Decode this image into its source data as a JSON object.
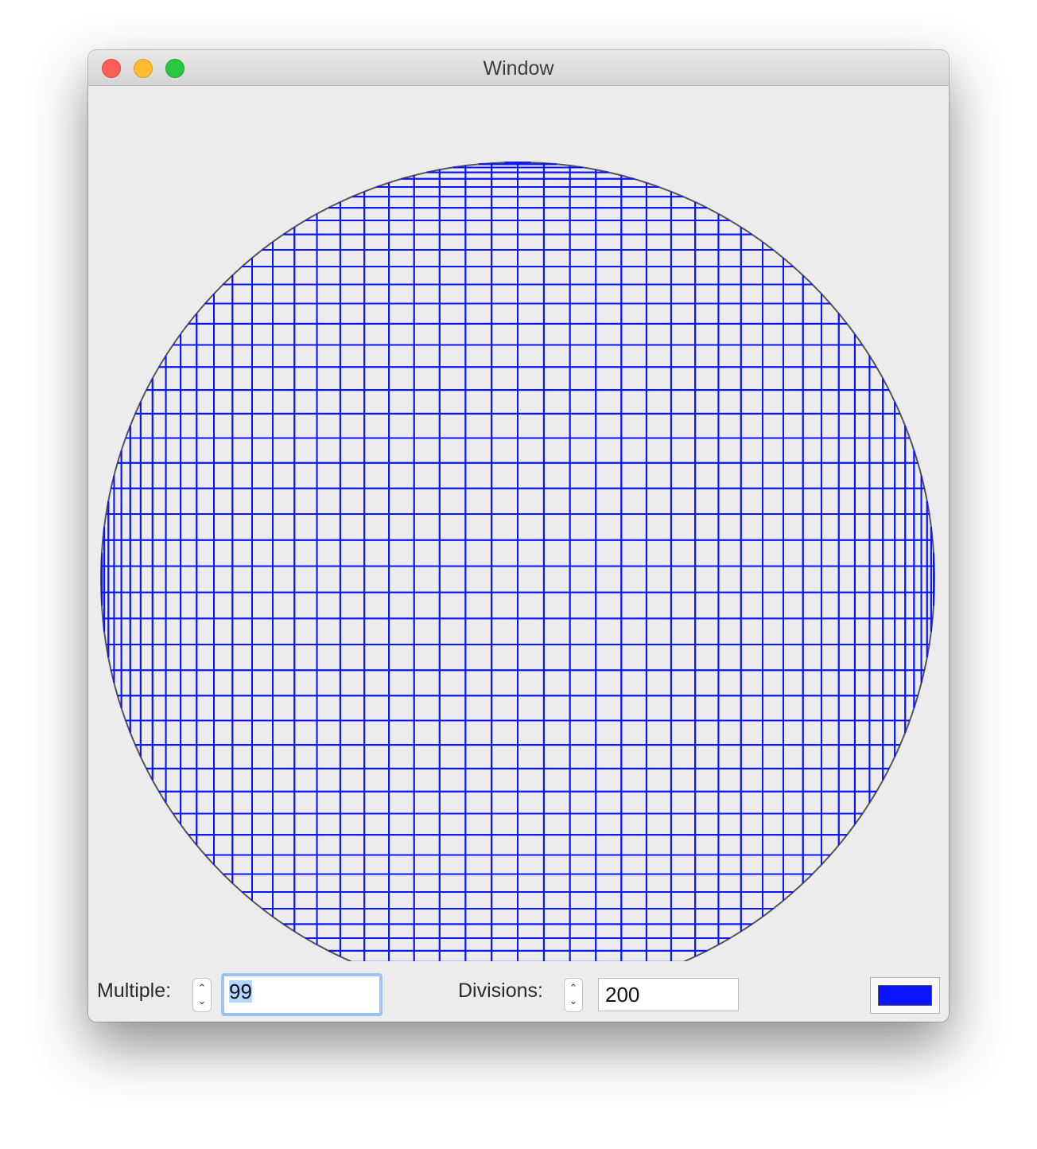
{
  "window": {
    "title": "Window"
  },
  "controls": {
    "multiple_label": "Multiple:",
    "multiple_value": "99",
    "divisions_label": "Divisions:",
    "divisions_value": "200",
    "stepper_up": "⌃",
    "stepper_down": "⌄"
  },
  "drawing": {
    "line_color": "#0a14ff",
    "circle_color": "#555555",
    "multiple": 99,
    "divisions": 200
  }
}
